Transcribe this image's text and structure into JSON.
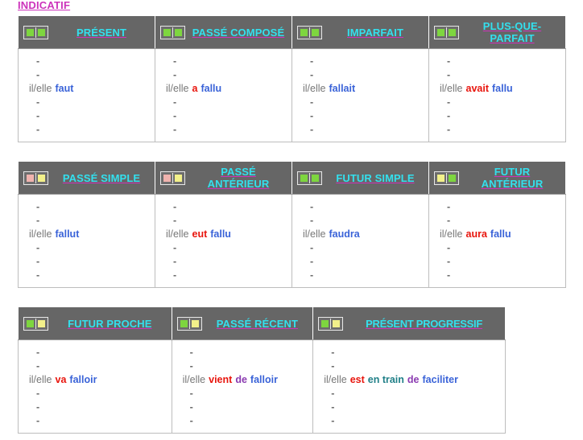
{
  "mood": {
    "label": "INDICATIF"
  },
  "colors": {
    "header_bg": "#666666",
    "header_text": "#33e0ee",
    "header_underline": "#cc33bb",
    "mood_title": "#cc33bb",
    "pronoun": "#777777",
    "verb_blue": "#3a63d8",
    "auxiliary_red": "#e8150d",
    "particle_purple": "#8a3ab0",
    "phrase_teal": "#1f7f87",
    "dash": "#6b6b6b",
    "cell_border": "#bdbdbd",
    "icon_green": "#7ed63f",
    "icon_yellow": "#f2f08a",
    "icon_pink": "#f0b3ae"
  },
  "dash": "-",
  "blocks": [
    {
      "name": "block-1",
      "columns": [
        {
          "tense": "PRÉSENT",
          "icon_colors": [
            "#7ed63f",
            "#7ed63f"
          ],
          "rows": [
            {
              "type": "dash"
            },
            {
              "type": "dash"
            },
            {
              "type": "conjugation",
              "pronoun": "il/elle",
              "parts": [
                {
                  "text": "faut",
                  "color": "blue"
                }
              ]
            },
            {
              "type": "dash"
            },
            {
              "type": "dash"
            },
            {
              "type": "dash"
            }
          ]
        },
        {
          "tense": "PASSÉ COMPOSÉ",
          "icon_colors": [
            "#7ed63f",
            "#7ed63f"
          ],
          "rows": [
            {
              "type": "dash"
            },
            {
              "type": "dash"
            },
            {
              "type": "conjugation",
              "pronoun": "il/elle",
              "parts": [
                {
                  "text": "a",
                  "color": "red"
                },
                {
                  "text": "fallu",
                  "color": "blue"
                }
              ]
            },
            {
              "type": "dash"
            },
            {
              "type": "dash"
            },
            {
              "type": "dash"
            }
          ]
        },
        {
          "tense": "IMPARFAIT",
          "icon_colors": [
            "#7ed63f",
            "#7ed63f"
          ],
          "rows": [
            {
              "type": "dash"
            },
            {
              "type": "dash"
            },
            {
              "type": "conjugation",
              "pronoun": "il/elle",
              "parts": [
                {
                  "text": "fallait",
                  "color": "blue"
                }
              ]
            },
            {
              "type": "dash"
            },
            {
              "type": "dash"
            },
            {
              "type": "dash"
            }
          ]
        },
        {
          "tense": "PLUS-QUE-PARFAIT",
          "icon_colors": [
            "#7ed63f",
            "#7ed63f"
          ],
          "rows": [
            {
              "type": "dash"
            },
            {
              "type": "dash"
            },
            {
              "type": "conjugation",
              "pronoun": "il/elle",
              "parts": [
                {
                  "text": "avait",
                  "color": "red"
                },
                {
                  "text": "fallu",
                  "color": "blue"
                }
              ]
            },
            {
              "type": "dash"
            },
            {
              "type": "dash"
            },
            {
              "type": "dash"
            }
          ]
        }
      ]
    },
    {
      "name": "block-2",
      "columns": [
        {
          "tense": "PASSÉ SIMPLE",
          "icon_colors": [
            "#f0b3ae",
            "#f2f08a"
          ],
          "rows": [
            {
              "type": "dash"
            },
            {
              "type": "dash"
            },
            {
              "type": "conjugation",
              "pronoun": "il/elle",
              "parts": [
                {
                  "text": "fallut",
                  "color": "blue"
                }
              ]
            },
            {
              "type": "dash"
            },
            {
              "type": "dash"
            },
            {
              "type": "dash"
            }
          ]
        },
        {
          "tense": "PASSÉ ANTÉRIEUR",
          "icon_colors": [
            "#f0b3ae",
            "#f2f08a"
          ],
          "rows": [
            {
              "type": "dash"
            },
            {
              "type": "dash"
            },
            {
              "type": "conjugation",
              "pronoun": "il/elle",
              "parts": [
                {
                  "text": "eut",
                  "color": "red"
                },
                {
                  "text": "fallu",
                  "color": "blue"
                }
              ]
            },
            {
              "type": "dash"
            },
            {
              "type": "dash"
            },
            {
              "type": "dash"
            }
          ]
        },
        {
          "tense": "FUTUR SIMPLE",
          "icon_colors": [
            "#7ed63f",
            "#7ed63f"
          ],
          "rows": [
            {
              "type": "dash"
            },
            {
              "type": "dash"
            },
            {
              "type": "conjugation",
              "pronoun": "il/elle",
              "parts": [
                {
                  "text": "faudra",
                  "color": "blue"
                }
              ]
            },
            {
              "type": "dash"
            },
            {
              "type": "dash"
            },
            {
              "type": "dash"
            }
          ]
        },
        {
          "tense": "FUTUR ANTÉRIEUR",
          "icon_colors": [
            "#f2f08a",
            "#7ed63f"
          ],
          "rows": [
            {
              "type": "dash"
            },
            {
              "type": "dash"
            },
            {
              "type": "conjugation",
              "pronoun": "il/elle",
              "parts": [
                {
                  "text": "aura",
                  "color": "red"
                },
                {
                  "text": "fallu",
                  "color": "blue"
                }
              ]
            },
            {
              "type": "dash"
            },
            {
              "type": "dash"
            },
            {
              "type": "dash"
            }
          ]
        }
      ]
    },
    {
      "name": "block-3",
      "columns": [
        {
          "tense": "FUTUR PROCHE",
          "icon_colors": [
            "#7ed63f",
            "#f2f08a"
          ],
          "rows": [
            {
              "type": "dash"
            },
            {
              "type": "dash"
            },
            {
              "type": "conjugation",
              "pronoun": "il/elle",
              "parts": [
                {
                  "text": "va",
                  "color": "red"
                },
                {
                  "text": "falloir",
                  "color": "blue"
                }
              ]
            },
            {
              "type": "dash"
            },
            {
              "type": "dash"
            },
            {
              "type": "dash"
            }
          ]
        },
        {
          "tense": "PASSÉ RÉCENT",
          "icon_colors": [
            "#7ed63f",
            "#f2f08a"
          ],
          "rows": [
            {
              "type": "dash"
            },
            {
              "type": "dash"
            },
            {
              "type": "conjugation",
              "pronoun": "il/elle",
              "parts": [
                {
                  "text": "vient",
                  "color": "red"
                },
                {
                  "text": "de",
                  "color": "purple"
                },
                {
                  "text": "falloir",
                  "color": "blue"
                }
              ]
            },
            {
              "type": "dash"
            },
            {
              "type": "dash"
            },
            {
              "type": "dash"
            }
          ]
        },
        {
          "tense": "PRÉSENT PROGRESSIF",
          "icon_colors": [
            "#7ed63f",
            "#f2f08a"
          ],
          "rows": [
            {
              "type": "dash"
            },
            {
              "type": "dash"
            },
            {
              "type": "conjugation",
              "pronoun": "il/elle",
              "parts": [
                {
                  "text": "est",
                  "color": "red"
                },
                {
                  "text": "en train",
                  "color": "teal"
                },
                {
                  "text": "de",
                  "color": "purple"
                },
                {
                  "text": "faciliter",
                  "color": "blue"
                }
              ]
            },
            {
              "type": "dash"
            },
            {
              "type": "dash"
            },
            {
              "type": "dash"
            }
          ]
        }
      ]
    }
  ]
}
